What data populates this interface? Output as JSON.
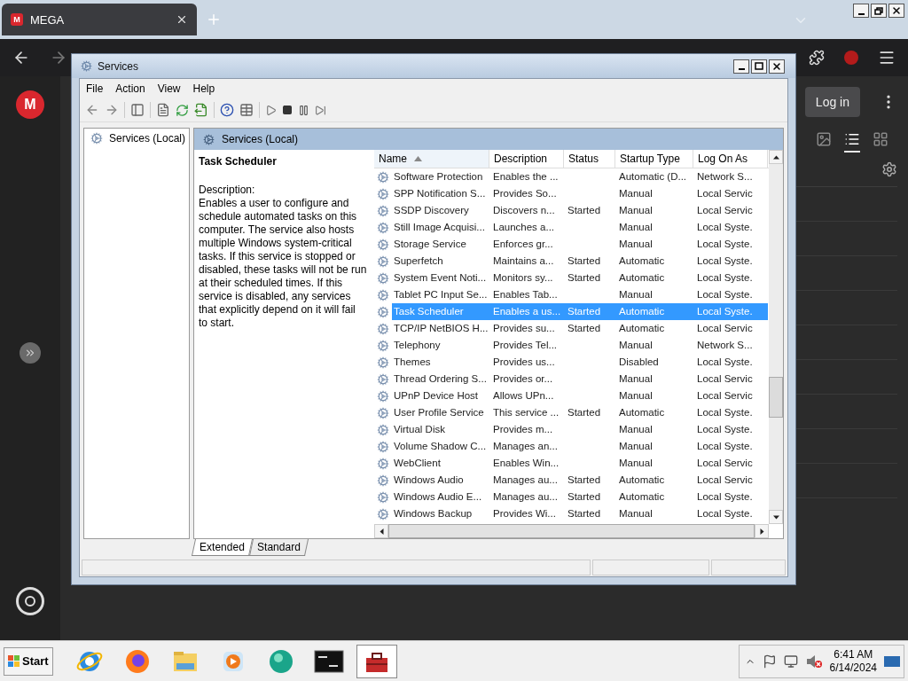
{
  "browser": {
    "tabs": [
      {
        "favicon": "M",
        "title": "MEGA",
        "selected": true
      }
    ],
    "sidebar": {
      "logo": "M"
    },
    "header": {
      "login": "Log in",
      "view_buttons": [
        {
          "selected": false
        },
        {
          "selected": true
        },
        {
          "selected": false
        }
      ]
    }
  },
  "services": {
    "title": "Services",
    "menu": [
      "File",
      "Action",
      "View",
      "Help"
    ],
    "tree": [
      "Services (Local)"
    ],
    "pane_title": "Services (Local)",
    "detail": {
      "name": "Task Scheduler",
      "label": "Description:",
      "text": "Enables a user to configure and schedule automated tasks on this computer. The service also hosts multiple Windows system-critical tasks. If this service is stopped or disabled, these tasks will not be run at their scheduled times. If this service is disabled, any services that explicitly depend on it will fail to start."
    },
    "columns": [
      {
        "label": "Name",
        "sorted": true
      },
      {
        "label": "Description",
        "sorted": false
      },
      {
        "label": "Status",
        "sorted": false
      },
      {
        "label": "Startup Type",
        "sorted": false
      },
      {
        "label": "Log On As",
        "sorted": false
      }
    ],
    "rows": [
      {
        "name": "Software Protection",
        "description": "Enables the ...",
        "status": "",
        "startup": "Automatic (D...",
        "logon": "Network S...",
        "selected": false
      },
      {
        "name": "SPP Notification S...",
        "description": "Provides So...",
        "status": "",
        "startup": "Manual",
        "logon": "Local Servic",
        "selected": false
      },
      {
        "name": "SSDP Discovery",
        "description": "Discovers n...",
        "status": "Started",
        "startup": "Manual",
        "logon": "Local Servic",
        "selected": false
      },
      {
        "name": "Still Image Acquisi...",
        "description": "Launches a...",
        "status": "",
        "startup": "Manual",
        "logon": "Local Syste.",
        "selected": false
      },
      {
        "name": "Storage Service",
        "description": "Enforces gr...",
        "status": "",
        "startup": "Manual",
        "logon": "Local Syste.",
        "selected": false
      },
      {
        "name": "Superfetch",
        "description": "Maintains a...",
        "status": "Started",
        "startup": "Automatic",
        "logon": "Local Syste.",
        "selected": false
      },
      {
        "name": "System Event Noti...",
        "description": "Monitors sy...",
        "status": "Started",
        "startup": "Automatic",
        "logon": "Local Syste.",
        "selected": false
      },
      {
        "name": "Tablet PC Input Se...",
        "description": "Enables Tab...",
        "status": "",
        "startup": "Manual",
        "logon": "Local Syste.",
        "selected": false
      },
      {
        "name": "Task Scheduler",
        "description": "Enables a us...",
        "status": "Started",
        "startup": "Automatic",
        "logon": "Local Syste.",
        "selected": true
      },
      {
        "name": "TCP/IP NetBIOS H...",
        "description": "Provides su...",
        "status": "Started",
        "startup": "Automatic",
        "logon": "Local Servic",
        "selected": false
      },
      {
        "name": "Telephony",
        "description": "Provides Tel...",
        "status": "",
        "startup": "Manual",
        "logon": "Network S...",
        "selected": false
      },
      {
        "name": "Themes",
        "description": "Provides us...",
        "status": "",
        "startup": "Disabled",
        "logon": "Local Syste.",
        "selected": false
      },
      {
        "name": "Thread Ordering S...",
        "description": "Provides or...",
        "status": "",
        "startup": "Manual",
        "logon": "Local Servic",
        "selected": false
      },
      {
        "name": "UPnP Device Host",
        "description": "Allows UPn...",
        "status": "",
        "startup": "Manual",
        "logon": "Local Servic",
        "selected": false
      },
      {
        "name": "User Profile Service",
        "description": "This service ...",
        "status": "Started",
        "startup": "Automatic",
        "logon": "Local Syste.",
        "selected": false
      },
      {
        "name": "Virtual Disk",
        "description": "Provides m...",
        "status": "",
        "startup": "Manual",
        "logon": "Local Syste.",
        "selected": false
      },
      {
        "name": "Volume Shadow C...",
        "description": "Manages an...",
        "status": "",
        "startup": "Manual",
        "logon": "Local Syste.",
        "selected": false
      },
      {
        "name": "WebClient",
        "description": "Enables Win...",
        "status": "",
        "startup": "Manual",
        "logon": "Local Servic",
        "selected": false
      },
      {
        "name": "Windows Audio",
        "description": "Manages au...",
        "status": "Started",
        "startup": "Automatic",
        "logon": "Local Servic",
        "selected": false
      },
      {
        "name": "Windows Audio E...",
        "description": "Manages au...",
        "status": "Started",
        "startup": "Automatic",
        "logon": "Local Syste.",
        "selected": false
      },
      {
        "name": "Windows Backup",
        "description": "Provides Wi...",
        "status": "Started",
        "startup": "Manual",
        "logon": "Local Syste.",
        "selected": false
      }
    ],
    "tabs": [
      {
        "label": "Extended",
        "selected": true
      },
      {
        "label": "Standard",
        "selected": false
      }
    ]
  },
  "taskbar": {
    "start": "Start",
    "apps": [
      {
        "selected": false
      },
      {
        "selected": false
      },
      {
        "selected": false
      },
      {
        "selected": false
      },
      {
        "selected": false
      },
      {
        "selected": false
      },
      {
        "selected": true
      }
    ],
    "clock": {
      "time": "6:41 AM",
      "date": "6/14/2024"
    }
  }
}
